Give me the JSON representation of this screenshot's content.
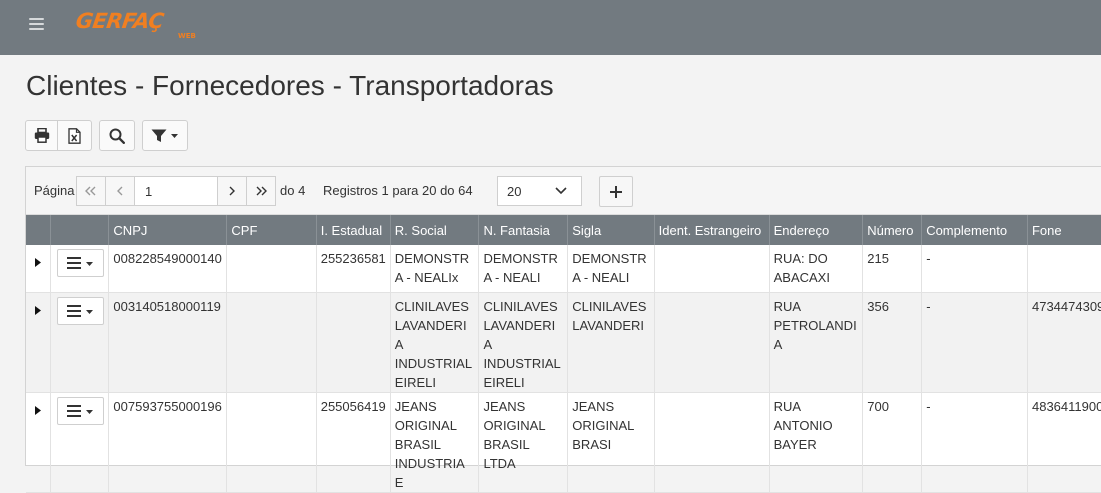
{
  "app": {
    "logo_text": "GERFAÇ",
    "logo_sub": "WEB"
  },
  "page_title": "Clientes - Fornecedores - Transportadoras",
  "pager": {
    "page_label": "Página",
    "page_value": "1",
    "of_label": "do 4",
    "records_label": "Registros 1 para 20 do 64",
    "page_size": "20"
  },
  "columns": [
    "",
    "",
    "CNPJ",
    "CPF",
    "I. Estadual",
    "R. Social",
    "N. Fantasia",
    "Sigla",
    "Ident. Estrangeiro",
    "Endereço",
    "Número",
    "Complemento",
    "Fone"
  ],
  "rows": [
    {
      "cnpj": "008228549000140",
      "cpf": "",
      "ie": "255236581",
      "rsocial": "DEMONSTRA - NEALIx",
      "nfantasia": "DEMONSTRA - NEALI",
      "sigla": "DEMONSTRA - NEALI",
      "ident": "",
      "endereco": "RUA: DO ABACAXI",
      "numero": "215",
      "complemento": "-",
      "fone": ""
    },
    {
      "cnpj": "003140518000119",
      "cpf": "",
      "ie": "",
      "rsocial": "CLINILAVES LAVANDERIA INDUSTRIAL EIRELI",
      "nfantasia": "CLINILAVES LAVANDERIA INDUSTRIAL EIRELI",
      "sigla": "CLINILAVES LAVANDERI",
      "ident": "",
      "endereco": "RUA PETROLANDIA",
      "numero": "356",
      "complemento": "-",
      "fone": "4734474309"
    },
    {
      "cnpj": "007593755000196",
      "cpf": "",
      "ie": "255056419",
      "rsocial": "JEANS ORIGINAL BRASIL INDUSTRIA E",
      "nfantasia": "JEANS ORIGINAL BRASIL LTDA",
      "sigla": "JEANS ORIGINAL BRASI",
      "ident": "",
      "endereco": "RUA ANTONIO BAYER",
      "numero": "700",
      "complemento": "-",
      "fone": "4836411900"
    }
  ],
  "colors": {
    "navbar": "#727a80",
    "logo": "#f07f21",
    "header": "#727a80"
  },
  "icons": [
    "menu-icon",
    "print-icon",
    "excel-icon",
    "search-icon",
    "filter-icon",
    "first-page-icon",
    "prev-page-icon",
    "next-page-icon",
    "last-page-icon",
    "chevron-down-icon",
    "plus-icon",
    "expand-row-icon",
    "row-menu-icon"
  ]
}
